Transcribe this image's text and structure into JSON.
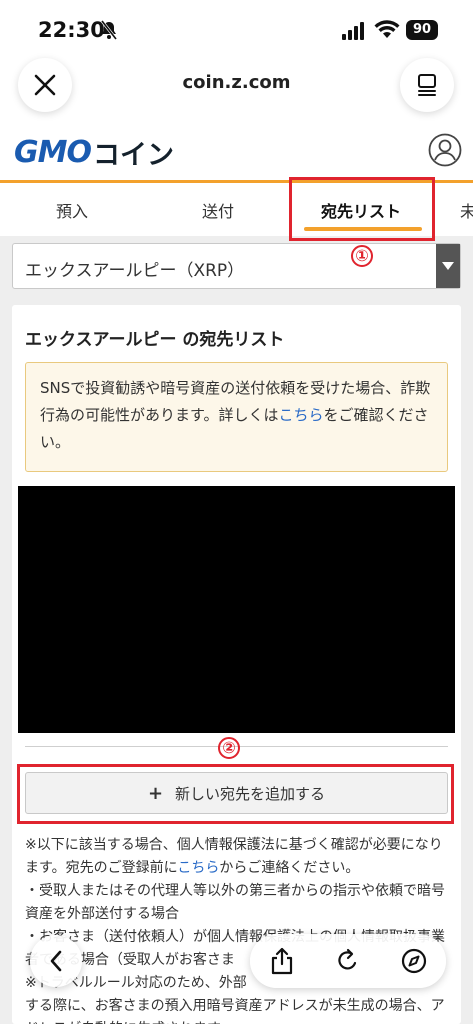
{
  "status_bar": {
    "time": "22:30",
    "battery": "90"
  },
  "browser": {
    "url": "coin.z.com"
  },
  "header": {
    "logo_gmo": "GMO",
    "logo_coin": "コイン"
  },
  "tabs": [
    {
      "label": "預入"
    },
    {
      "label": "送付"
    },
    {
      "label": "宛先リスト"
    },
    {
      "label": "未"
    }
  ],
  "annotations": {
    "badge_1": "①",
    "badge_2": "②",
    "highlight_color": "#e0242e"
  },
  "currency_select": {
    "value": "エックスアールピー（XRP）"
  },
  "card": {
    "title": "エックスアールピー の宛先リスト",
    "notice_text_1": "SNSで投資勧誘や暗号資産の送付依頼を受けた場合、詐欺行為の可能性があります。詳しくは",
    "notice_link": "こちら",
    "notice_text_2": "をご確認ください。",
    "add_button_label": "新しい宛先を追加する",
    "notes_1a": "※以下に該当する場合、個人情報保護法に基づく確認が必要になります。宛先のご登録前に",
    "notes_1_link": "こちら",
    "notes_1b": "からご連絡ください。",
    "notes_2": "・受取人またはその代理人等以外の第三者からの指示や依頼で暗号資産を外部送付する場合",
    "notes_3": "・お客さま（送付依頼人）が個人情報保護法上の個人情報取扱事業者である場合（受取人がお客さま",
    "notes_4": "※トラベルルール対応のため、外部",
    "notes_5": "する際に、お客さまの預入用暗号資産アドレスが未生成の場合、アドレスが自動的に生成されます。"
  },
  "colors": {
    "accent": "#f3a12c",
    "brand_blue": "#1a5bb0",
    "link": "#2a6bc7"
  }
}
